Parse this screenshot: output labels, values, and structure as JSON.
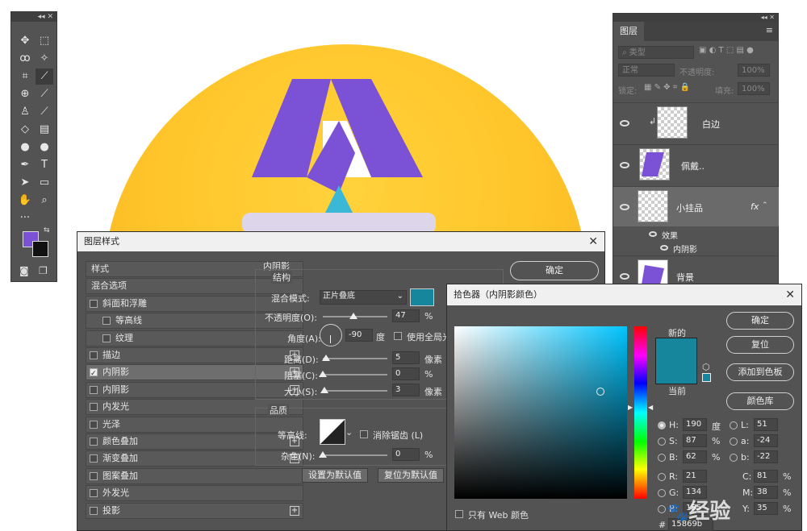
{
  "colors": {
    "fg_swatch": "#7b52d6",
    "bg_swatch": "#111111",
    "shadow_color": "#15869b",
    "artwork_purple": "#7b52d6",
    "artwork_teal": "#3ab8d6"
  },
  "layers_panel": {
    "tab": "图层",
    "search_placeholder": "类型",
    "blend_mode": "正常",
    "opacity_label": "不透明度:",
    "opacity_value": "100%",
    "lock_label": "锁定:",
    "fill_label": "填充:",
    "fill_value": "100%",
    "layers": [
      {
        "name": "白边"
      },
      {
        "name": "佩戴.."
      },
      {
        "name": "小挂品",
        "fx": "fx"
      },
      {
        "name": "背景"
      }
    ],
    "effects_label": "效果",
    "effect_item": "内阴影"
  },
  "style_dialog": {
    "title": "图层样式",
    "sidebar": [
      {
        "label": "样式",
        "check": false,
        "plus": false
      },
      {
        "label": "混合选项",
        "check": false,
        "plus": false
      },
      {
        "label": "斜面和浮雕",
        "check": true,
        "plus": false
      },
      {
        "label": "等高线",
        "check": true,
        "plus": false
      },
      {
        "label": "纹理",
        "check": true,
        "plus": false
      },
      {
        "label": "描边",
        "check": true,
        "plus": true
      },
      {
        "label": "内阴影",
        "check": true,
        "plus": true
      },
      {
        "label": "内阴影",
        "check": true,
        "plus": true
      },
      {
        "label": "内发光",
        "check": true,
        "plus": false
      },
      {
        "label": "光泽",
        "check": true,
        "plus": false
      },
      {
        "label": "颜色叠加",
        "check": true,
        "plus": true
      },
      {
        "label": "渐变叠加",
        "check": true,
        "plus": true
      },
      {
        "label": "图案叠加",
        "check": true,
        "plus": false
      },
      {
        "label": "外发光",
        "check": true,
        "plus": false
      },
      {
        "label": "投影",
        "check": true,
        "plus": true
      }
    ],
    "section_title": "内阴影",
    "structure_title": "结构",
    "blend_mode_label": "混合模式:",
    "blend_mode_value": "正片叠底",
    "opacity_label": "不透明度(O):",
    "opacity_value": "47",
    "angle_label": "角度(A):",
    "angle_value": "-90",
    "degree_unit": "度",
    "global_light_label": "使用全局光",
    "distance_label": "距离(D):",
    "distance_value": "5",
    "choke_label": "阻塞(C):",
    "choke_value": "0",
    "size_label": "大小(S):",
    "size_value": "3",
    "pixel_unit": "像素",
    "percent_unit": "%",
    "quality_title": "品质",
    "contour_label": "等高线:",
    "antialias_label": "消除锯齿 (L)",
    "noise_label": "杂色(N):",
    "noise_value": "0",
    "set_default_label": "设置为默认值",
    "reset_default_label": "复位为默认值",
    "ok_label": "确定",
    "opacity_level": 0.47,
    "distance_level": 0.05,
    "choke_level": 0,
    "size_level": 0.03,
    "noise_level": 0
  },
  "color_picker": {
    "title": "拾色器（内阴影颜色）",
    "new_label": "新的",
    "current_label": "当前",
    "ok_label": "确定",
    "reset_label": "复位",
    "add_swatch_label": "添加到色板",
    "library_label": "颜色库",
    "web_only_label": "只有 Web 颜色",
    "fields": {
      "H": {
        "label": "H:",
        "value": "190",
        "unit": "度"
      },
      "S": {
        "label": "S:",
        "value": "87",
        "unit": "%"
      },
      "B": {
        "label": "B:",
        "value": "62",
        "unit": "%"
      },
      "R": {
        "label": "R:",
        "value": "21",
        "unit": ""
      },
      "G": {
        "label": "G:",
        "value": "134",
        "unit": ""
      },
      "Bl": {
        "label": "B:",
        "value": "155",
        "unit": ""
      },
      "L": {
        "label": "L:",
        "value": "51",
        "unit": ""
      },
      "a": {
        "label": "a:",
        "value": "-24",
        "unit": ""
      },
      "b": {
        "label": "b:",
        "value": "-22",
        "unit": ""
      },
      "C": {
        "label": "C:",
        "value": "81",
        "unit": "%"
      },
      "M": {
        "label": "M:",
        "value": "38",
        "unit": "%"
      },
      "Y": {
        "label": "Y:",
        "value": "35",
        "unit": "%"
      }
    },
    "hex_label": "#",
    "hex_value": "15869b"
  },
  "watermark": "经验"
}
